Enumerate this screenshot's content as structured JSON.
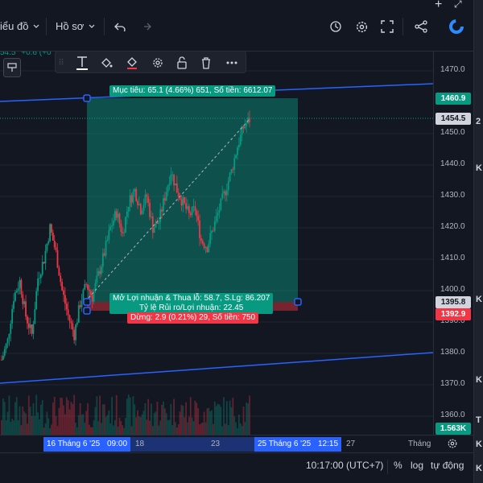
{
  "toolbar": {
    "chart_type_label": "iểu đồ",
    "profile_label": "Hồ sơ"
  },
  "legend": {
    "price_text": "54.5",
    "change_text": "+0.6 (+0"
  },
  "price_axis": {
    "ticks": [
      "1470.0",
      "1450.0",
      "1440.0",
      "1430.0",
      "1420.0",
      "1410.0",
      "1400.0",
      "1390.0",
      "1380.0",
      "1370.0",
      "1360.0"
    ],
    "tag_target": "1460.9",
    "tag_current": "1454.5",
    "tag_entry": "1395.8",
    "tag_stop": "1392.9",
    "tag_volume": "1.563K"
  },
  "time_axis": {
    "labels": [
      "18",
      "23",
      "27",
      "Tháng"
    ],
    "start_tag": "16 Tháng 6 '25",
    "start_time": "09:00",
    "end_tag": "25 Tháng 6 '25",
    "end_time": "12:15"
  },
  "position_tool": {
    "target_label": "Mục tiêu: 65.1 (4.66%) 651, Số tiền: 6612.07",
    "pnl_label": "Mở Lợi nhuận & Thua lỗ: 58.7, S.Lg: 86.207",
    "ratio_label": "Tỷ lệ Rủi ro/Lợi nhuận: 22.45",
    "stop_label": "Dừng: 2.9 (0.21%) 29, Số tiền: 750"
  },
  "statusbar": {
    "time": "10:17:00 (UTC+7)",
    "percent": "%",
    "log": "log",
    "auto": "tự động"
  },
  "right_strip": {
    "letters": [
      "2",
      "K",
      "K",
      "K",
      "T",
      "K",
      "K"
    ]
  },
  "colors": {
    "background": "#131722",
    "up": "#089981",
    "down": "#f23645",
    "accent": "#2962ff",
    "trendline": "#2962ff"
  },
  "chart_data": {
    "type": "candlestick",
    "ylim": [
      1358,
      1475
    ],
    "y_ticks": [
      1470,
      1450,
      1440,
      1430,
      1420,
      1410,
      1400,
      1390,
      1380,
      1370,
      1360
    ],
    "x_ticks": [
      "16 Tháng 6 '25",
      "18",
      "23",
      "25 Tháng 6 '25",
      "27",
      "Tháng"
    ],
    "position": {
      "entry": 1395.8,
      "target": 1460.9,
      "stop": 1392.9,
      "current": 1454.5
    },
    "close_path": [
      1378,
      1384,
      1398,
      1403,
      1392,
      1386,
      1404,
      1410,
      1420,
      1412,
      1400,
      1392,
      1386,
      1396,
      1402,
      1398,
      1405,
      1412,
      1420,
      1425,
      1418,
      1428,
      1432,
      1426,
      1430,
      1420,
      1422,
      1430,
      1438,
      1432,
      1428,
      1424,
      1426,
      1416,
      1414,
      1420,
      1426,
      1432,
      1438,
      1446,
      1452,
      1454.5
    ]
  }
}
